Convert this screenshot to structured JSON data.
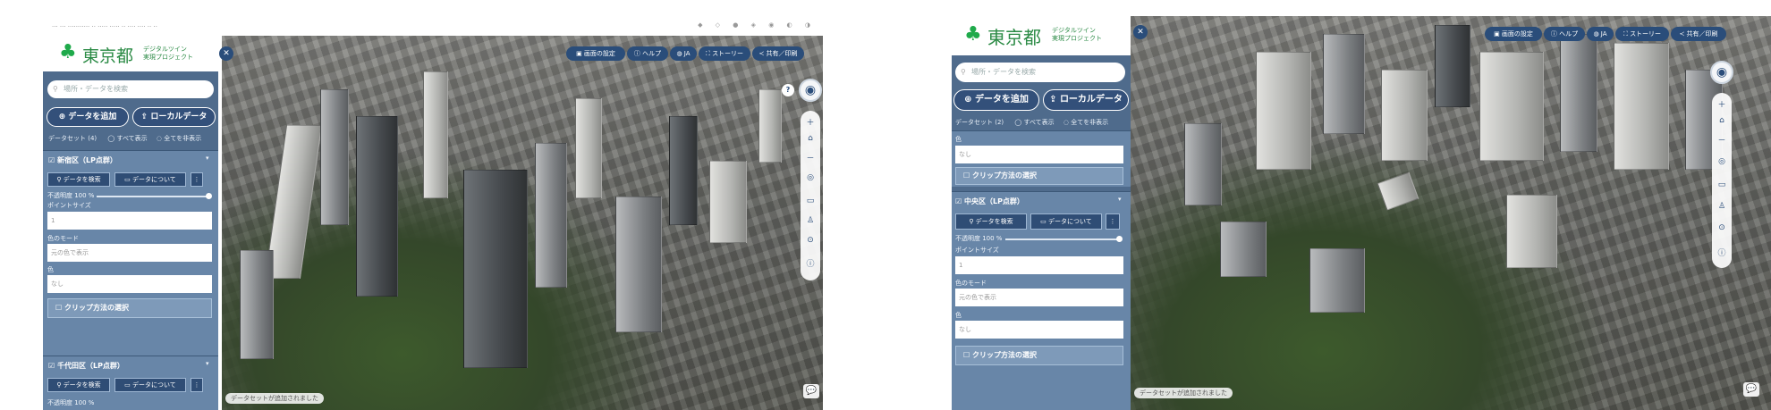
{
  "left": {
    "browser": {
      "url_text": "··· ··· ··········· ·· ····· ····· ·· ···· ···· ·· ··",
      "extension_icons": "◆ ◇ ● ◈ ◉ ◐ ◑"
    },
    "logo": {
      "text": "東京都",
      "sub": "デジタルツイン\n実現プロジェクト"
    },
    "search_placeholder": "場所・データを検索",
    "add_data": "データを追加",
    "local_data": "ローカルデータ",
    "dataset_row": {
      "count": "データセット (4)",
      "show_all": "すべて表示",
      "hide_all": "全てを非表示"
    },
    "layer1": {
      "title": "新宿区（LP点群）",
      "search_btn": "データを検索",
      "about_btn": "データについて",
      "opacity_label": "不透明度 100 %",
      "point_size_label": "ポイントサイズ",
      "point_size_value": "1",
      "color_mode_label": "色のモード",
      "color_mode_value": "元の色で表示",
      "color_label": "色",
      "color_value": "なし",
      "clip_label": "クリップ方法の選択"
    },
    "layer2": {
      "title": "千代田区（LP点群）",
      "search_btn": "データを検索",
      "about_btn": "データについて",
      "opacity_label": "不透明度 100 %"
    },
    "top_buttons": [
      "画面の設定",
      "ヘルプ",
      "JA",
      "ストーリー",
      "共有／印刷"
    ],
    "status_text": "データセットが追加されました"
  },
  "right": {
    "logo": {
      "text": "東京都",
      "sub": "デジタルツイン\n実現プロジェクト"
    },
    "search_placeholder": "場所・データを検索",
    "add_data": "データを追加",
    "local_data": "ローカルデータ",
    "dataset_row": {
      "count": "データセット (2)",
      "show_all": "すべて表示",
      "hide_all": "全てを非表示"
    },
    "prev_layer": {
      "color_label": "色",
      "color_value": "なし",
      "clip_label": "クリップ方法の選択"
    },
    "layer": {
      "title": "中央区（LP点群）",
      "search_btn": "データを検索",
      "about_btn": "データについて",
      "opacity_label": "不透明度 100 %",
      "point_size_label": "ポイントサイズ",
      "point_size_value": "1",
      "color_mode_label": "色のモード",
      "color_mode_value": "元の色で表示",
      "color_label": "色",
      "color_value": "なし",
      "clip_label": "クリップ方法の選択"
    },
    "top_buttons": [
      "画面の設定",
      "ヘルプ",
      "JA",
      "ストーリー",
      "共有／印刷"
    ],
    "status_text": "データセットが追加されました"
  },
  "icons": {
    "zoom_in": "＋",
    "zoom_out": "－",
    "home": "⌂",
    "locate": "◎",
    "compass": "◉",
    "help": "?",
    "chat": "💬",
    "close": "✕",
    "search": "⚲",
    "menu": "⋮",
    "info": "ⓘ"
  },
  "colors": {
    "panel": "#4f6b8c",
    "accent": "#2a4d7a",
    "brand_green": "#1faa4b"
  }
}
